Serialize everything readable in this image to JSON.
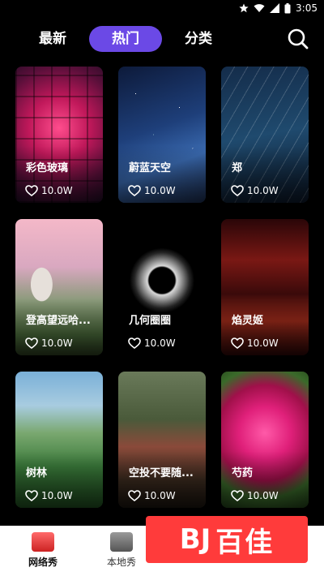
{
  "status": {
    "time": "3:05"
  },
  "tabs": {
    "latest": "最新",
    "hot": "热门",
    "category": "分类"
  },
  "cards": [
    {
      "title": "彩色玻璃",
      "likes": "10.0W"
    },
    {
      "title": "蔚蓝天空",
      "likes": "10.0W"
    },
    {
      "title": "郑",
      "likes": "10.0W"
    },
    {
      "title": "登高望远哈...",
      "likes": "10.0W"
    },
    {
      "title": "几何圈圈",
      "likes": "10.0W"
    },
    {
      "title": "焰灵姬",
      "likes": "10.0W"
    },
    {
      "title": "树林",
      "likes": "10.0W"
    },
    {
      "title": "空投不要随...",
      "likes": "10.0W"
    },
    {
      "title": "芍药",
      "likes": "10.0W"
    }
  ],
  "bottom_nav": {
    "net": "网络秀",
    "local": "本地秀"
  },
  "watermark": {
    "logo": "BJ",
    "text": "百佳"
  },
  "colors": {
    "accent": "#6b49e6",
    "watermark": "#ff3b3b"
  }
}
